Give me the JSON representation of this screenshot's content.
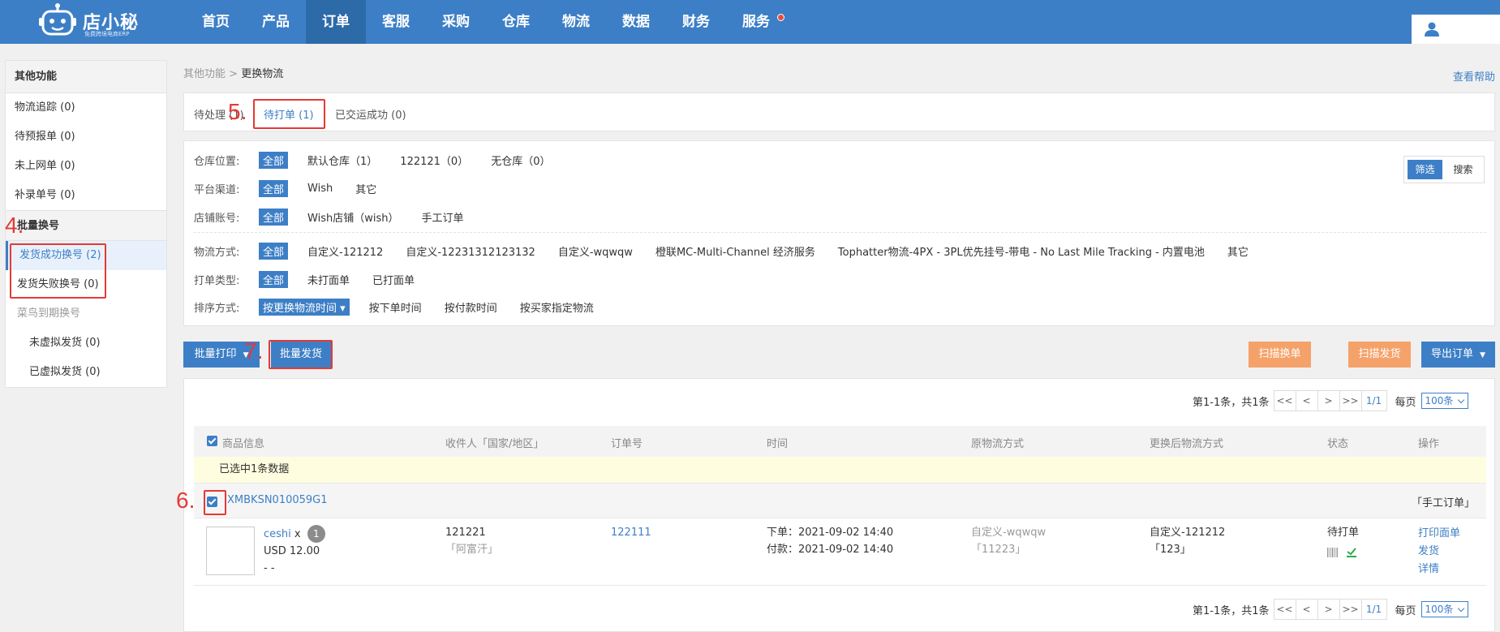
{
  "app": {
    "logo_title": "店小秘",
    "logo_sub": "免费跨境电商ERP",
    "nav": [
      "首页",
      "产品",
      "订单",
      "客服",
      "采购",
      "仓库",
      "物流",
      "数据",
      "财务",
      "服务"
    ],
    "active_nav": "订单"
  },
  "sidebar": {
    "head": "其他功能",
    "items": [
      "物流追踪 (0)",
      "待预报单 (0)",
      "未上网单 (0)",
      "补录单号 (0)"
    ],
    "group": "批量换号",
    "sub_items": [
      "发货成功换号 (2)",
      "发货失败换号 (0)"
    ],
    "muted_item": "菜鸟到期换号",
    "deep_items": [
      "未虚拟发货 (0)",
      "已虚拟发货 (0)"
    ]
  },
  "breadcrumb": {
    "parent": "其他功能",
    "sep": ">",
    "current": "更换物流"
  },
  "help_link": "查看帮助",
  "tabs": [
    "待处理 (1)",
    "待打单 (1)",
    "已交运成功 (0)"
  ],
  "filters": {
    "warehouse": {
      "label": "仓库位置:",
      "options": [
        "全部",
        "默认仓库（1）",
        "122121（0）",
        "无仓库（0）"
      ]
    },
    "channel": {
      "label": "平台渠道:",
      "options": [
        "全部",
        "Wish",
        "其它"
      ]
    },
    "store": {
      "label": "店铺账号:",
      "options": [
        "全部",
        "Wish店铺（wish）",
        "手工订单"
      ]
    },
    "logistics": {
      "label": "物流方式:",
      "options": [
        "全部",
        "自定义-121212",
        "自定义-12231312123132",
        "自定义-wqwqw",
        "橙联MC-Multi-Channel 经济服务",
        "Tophatter物流-4PX - 3PL优先挂号-带电 - No Last Mile Tracking - 内置电池",
        "其它"
      ]
    },
    "print_type": {
      "label": "打单类型:",
      "options": [
        "全部",
        "未打面单",
        "已打面单"
      ]
    },
    "sort": {
      "label": "排序方式:",
      "options": [
        "按更换物流时间 ▾",
        "按下单时间",
        "按付款时间",
        "按买家指定物流"
      ]
    },
    "toggle": [
      "筛选",
      "搜索"
    ]
  },
  "actions": {
    "batch_print": "批量打印",
    "batch_ship": "批量发货",
    "scan_swap": "扫描换单",
    "scan_ship": "扫描发货",
    "export": "导出订单"
  },
  "pager": {
    "info": "第1-1条，共1条",
    "first": "<<",
    "prev": "<",
    "next": ">",
    "last": ">>",
    "page": "1/1",
    "per_page_label": "每页",
    "per_page": "100条"
  },
  "table": {
    "headers": [
      "商品信息",
      "收件人「国家/地区」",
      "订单号",
      "时间",
      "原物流方式",
      "更换后物流方式",
      "状态",
      "操作"
    ],
    "selected_banner": "已选中1条数据",
    "order": {
      "sku": "XMBKSN010059G1",
      "type": "「手工订单」",
      "product_name": "ceshi",
      "qty_prefix": "x",
      "qty": "1",
      "price": "USD 12.00",
      "extra": "- -",
      "recipient": "121221",
      "country": "「阿富汗」",
      "order_no": "122111",
      "order_time": "下单：2021-09-02 14:40",
      "pay_time": "付款：2021-09-02 14:40",
      "orig_logistics": "自定义-wqwqw",
      "orig_tracking": "「11223」",
      "new_logistics": "自定义-121212",
      "new_tracking": "「123」",
      "status": "待打单",
      "ops": [
        "打印面单",
        "发货",
        "详情"
      ]
    }
  },
  "annotations": [
    "4.",
    "5.",
    "6.",
    "7."
  ],
  "colors": {
    "primary": "#3d7fc6",
    "orange": "#f5a26a",
    "annotation": "#e53935"
  }
}
